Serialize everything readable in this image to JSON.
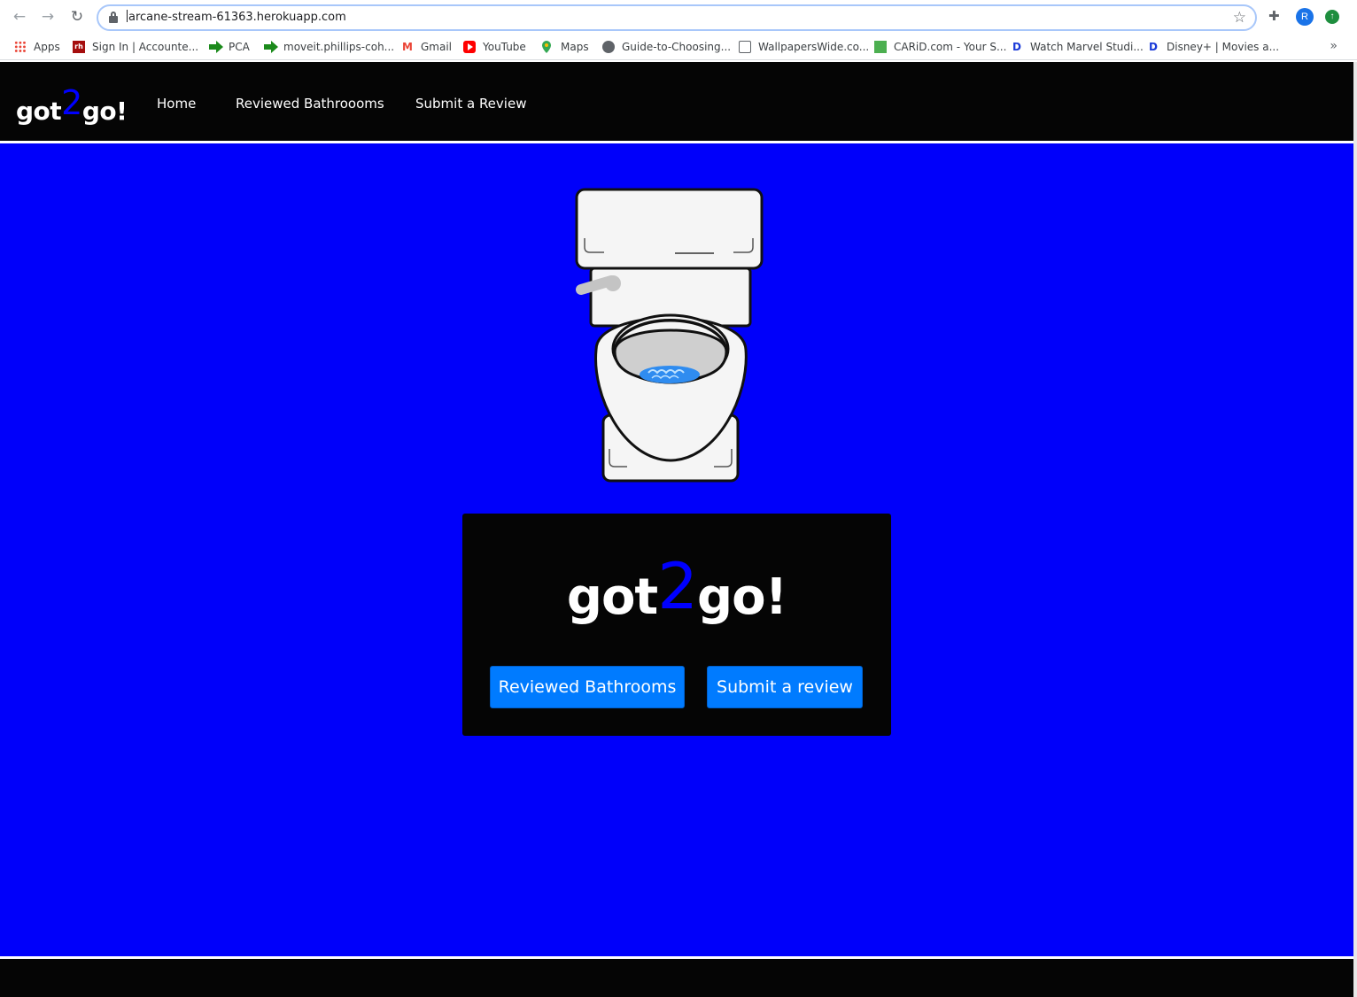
{
  "browser": {
    "url": "arcane-stream-61363.herokuapp.com",
    "profile_initial": "R",
    "bookmarks": [
      {
        "label": "Apps",
        "icon": "apps-grid-icon"
      },
      {
        "label": "Sign In | Accounte...",
        "icon": "rh-icon"
      },
      {
        "label": "PCA",
        "icon": "green-arrow-icon"
      },
      {
        "label": "moveit.phillips-coh...",
        "icon": "green-arrow-icon"
      },
      {
        "label": "Gmail",
        "icon": "gmail-icon"
      },
      {
        "label": "YouTube",
        "icon": "youtube-icon"
      },
      {
        "label": "Maps",
        "icon": "maps-pin-icon"
      },
      {
        "label": "Guide-to-Choosing...",
        "icon": "globe-icon"
      },
      {
        "label": "WallpapersWide.co...",
        "icon": "wallpaper-icon"
      },
      {
        "label": "CARiD.com - Your S...",
        "icon": "carid-icon"
      },
      {
        "label": "Watch Marvel Studi...",
        "icon": "disney-icon"
      },
      {
        "label": "Disney+ | Movies a...",
        "icon": "disney-icon"
      }
    ],
    "more_label": "»"
  },
  "site": {
    "brand_prefix": "got",
    "brand_two": "2",
    "brand_suffix": "go!",
    "nav": [
      "Home",
      "Reviewed Bathroooms",
      "Submit a Review"
    ],
    "hero": {
      "title_prefix": "got",
      "title_two": "2",
      "title_suffix": "go!",
      "button_reviewed": "Reviewed Bathrooms",
      "button_submit": "Submit a review"
    },
    "colors": {
      "page_bg": "#0000fa",
      "nav_bg": "#050505",
      "accent_two": "#0000ff",
      "button_bg": "#007bff"
    }
  }
}
